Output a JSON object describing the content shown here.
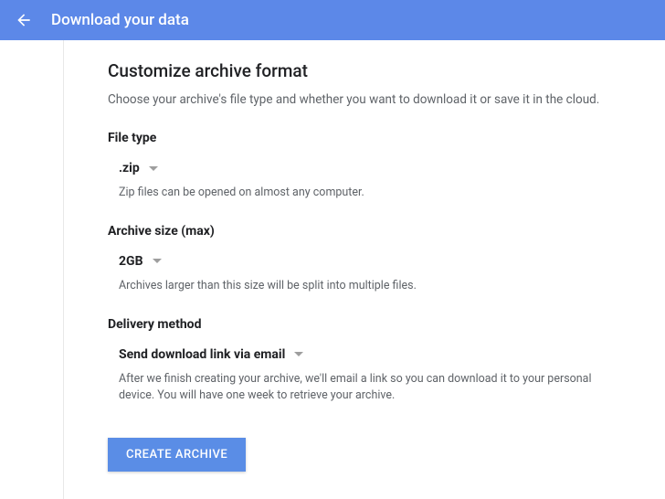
{
  "header": {
    "title": "Download your data"
  },
  "page": {
    "title": "Customize archive format",
    "subtitle": "Choose your archive's file type and whether you want to download it or save it in the cloud."
  },
  "fileType": {
    "label": "File type",
    "value": ".zip",
    "help": "Zip files can be opened on almost any computer."
  },
  "archiveSize": {
    "label": "Archive size (max)",
    "value": "2GB",
    "help": "Archives larger than this size will be split into multiple files."
  },
  "deliveryMethod": {
    "label": "Delivery method",
    "value": "Send download link via email",
    "help": "After we finish creating your archive, we'll email a link so you can download it to your personal device. You will have one week to retrieve your archive."
  },
  "button": {
    "create": "CREATE ARCHIVE"
  }
}
